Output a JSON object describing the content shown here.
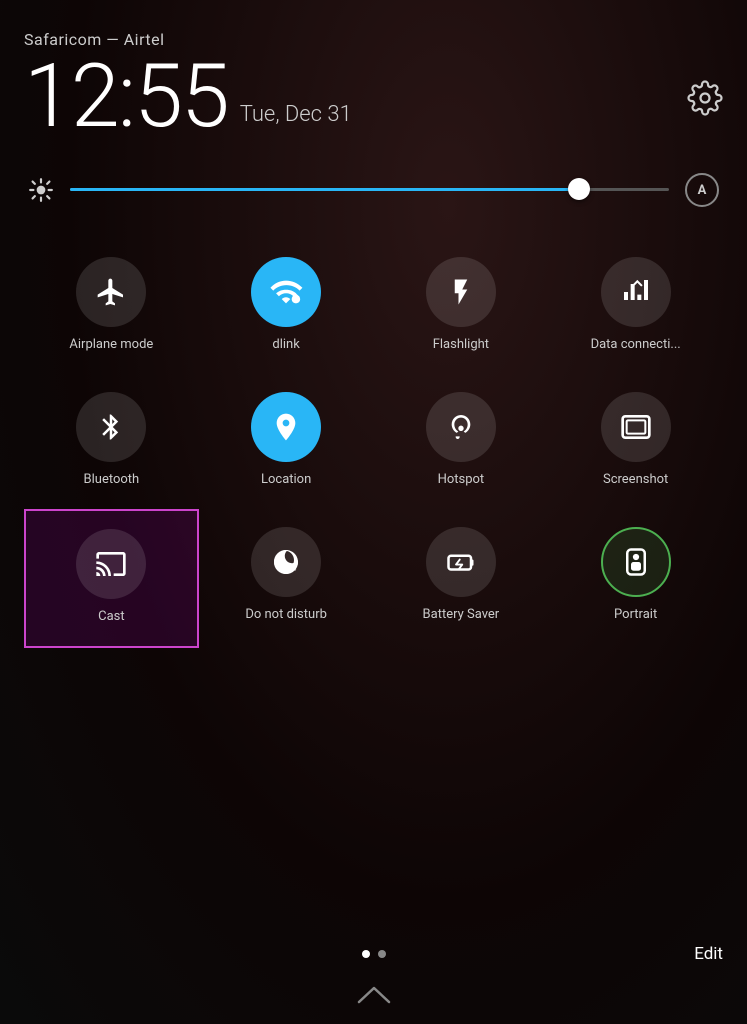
{
  "header": {
    "carrier": "Safaricom — Airtel",
    "time": "12:55",
    "date": "Tue, Dec 31"
  },
  "brightness": {
    "auto_label": "A",
    "value": 85
  },
  "quickSettings": {
    "items": [
      {
        "id": "airplane-mode",
        "label": "Airplane mode",
        "active": false,
        "icon": "airplane"
      },
      {
        "id": "wifi",
        "label": "dlink",
        "active": true,
        "icon": "wifi"
      },
      {
        "id": "flashlight",
        "label": "Flashlight",
        "active": false,
        "icon": "flashlight"
      },
      {
        "id": "data-connection",
        "label": "Data connecti...",
        "active": false,
        "icon": "data"
      },
      {
        "id": "bluetooth",
        "label": "Bluetooth",
        "active": false,
        "icon": "bluetooth"
      },
      {
        "id": "location",
        "label": "Location",
        "active": true,
        "icon": "location"
      },
      {
        "id": "hotspot",
        "label": "Hotspot",
        "active": false,
        "icon": "hotspot"
      },
      {
        "id": "screenshot",
        "label": "Screenshot",
        "active": false,
        "icon": "screenshot"
      },
      {
        "id": "cast",
        "label": "Cast",
        "active": false,
        "icon": "cast",
        "highlighted": true
      },
      {
        "id": "do-not-disturb",
        "label": "Do not disturb",
        "active": false,
        "icon": "dnd"
      },
      {
        "id": "battery-saver",
        "label": "Battery Saver",
        "active": false,
        "icon": "battery-saver"
      },
      {
        "id": "portrait",
        "label": "Portrait",
        "active": false,
        "icon": "portrait"
      }
    ]
  },
  "bottom": {
    "edit_label": "Edit",
    "dots": [
      {
        "active": true
      },
      {
        "active": false
      }
    ]
  }
}
